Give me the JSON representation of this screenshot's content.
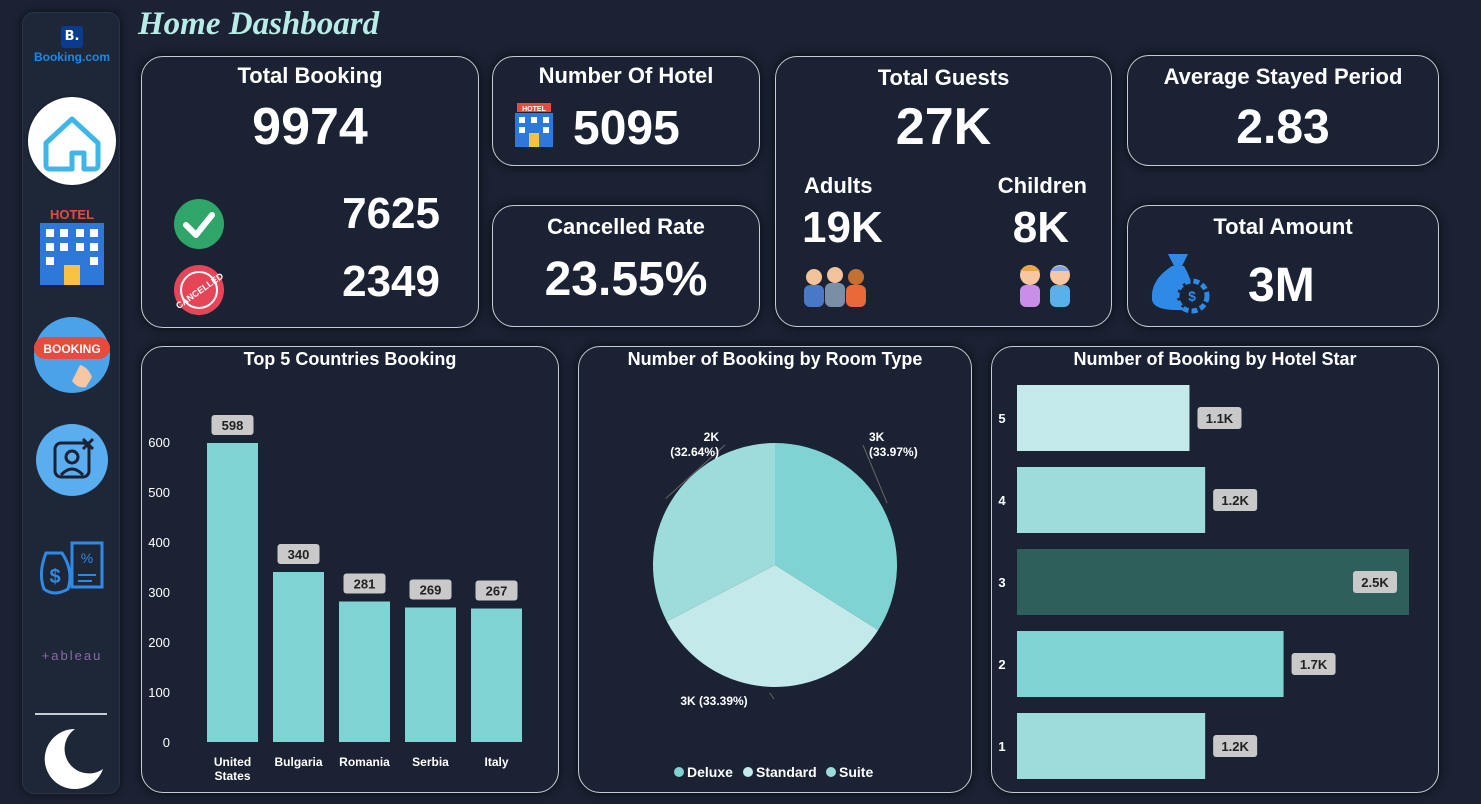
{
  "page_title": "Home Dashboard",
  "brand": {
    "letter": "B.",
    "name": "Booking.com"
  },
  "sidebar": {
    "items": [
      {
        "label": "home-icon"
      },
      {
        "label": "hotel-icon",
        "text": "HOTEL"
      },
      {
        "label": "booking-icon",
        "text": "BOOKING"
      },
      {
        "label": "cancel-user-icon"
      },
      {
        "label": "money-icon"
      },
      {
        "label": "tableau-logo",
        "text": "+ableau"
      },
      {
        "label": "moon-icon"
      }
    ]
  },
  "kpis": {
    "total_booking": {
      "title": "Total Booking",
      "value": "9974",
      "confirmed": "7625",
      "cancelled": "2349",
      "cancelled_stamp": "CANCELLED"
    },
    "number_of_hotel": {
      "title": "Number Of Hotel",
      "value": "5095",
      "icon_text": "HOTEL"
    },
    "cancelled_rate": {
      "title": "Cancelled Rate",
      "value": "23.55%"
    },
    "total_guests": {
      "title": "Total Guests",
      "value": "27K",
      "adults_label": "Adults",
      "adults_value": "19K",
      "children_label": "Children",
      "children_value": "8K"
    },
    "avg_stay": {
      "title": "Average Stayed Period",
      "value": "2.83"
    },
    "total_amount": {
      "title": "Total Amount",
      "value": "3M"
    }
  },
  "colors": {
    "bar": "#7fd3d3",
    "bar_dark": "#2f5f5b",
    "pie_deluxe": "#7fd3d3",
    "pie_standard": "#c3e9ea",
    "pie_suite": "#9edcdc",
    "bg": "#1a2233"
  },
  "chart_data": [
    {
      "type": "bar",
      "title": "Top 5 Countries Booking",
      "categories": [
        "United States",
        "Bulgaria",
        "Romania",
        "Serbia",
        "Italy"
      ],
      "values": [
        598,
        340,
        281,
        269,
        267
      ],
      "yticks": [
        0,
        100,
        200,
        300,
        400,
        500,
        600
      ],
      "ylim": [
        0,
        660
      ],
      "data_labels": [
        "598",
        "340",
        "281",
        "269",
        "267"
      ]
    },
    {
      "type": "pie",
      "title": "Number of Booking by Room Type",
      "slices": [
        {
          "name": "Deluxe",
          "value": 33.97,
          "label_value": "3K",
          "label_pct": "(33.97%)"
        },
        {
          "name": "Standard",
          "value": 33.39,
          "label_value": "3K",
          "label_pct": "(33.39%)"
        },
        {
          "name": "Suite",
          "value": 32.64,
          "label_value": "2K",
          "label_pct": "(32.64%)"
        }
      ],
      "legend": [
        "Deluxe",
        "Standard",
        "Suite"
      ]
    },
    {
      "type": "bar",
      "orientation": "horizontal",
      "title": "Number of Booking by Hotel Star",
      "categories": [
        "5",
        "4",
        "3",
        "2",
        "1"
      ],
      "values": [
        1100,
        1200,
        2500,
        1700,
        1200
      ],
      "data_labels": [
        "1.1K",
        "1.2K",
        "2.5K",
        "1.7K",
        "1.2K"
      ],
      "xlim": [
        0,
        2500
      ],
      "highlight": "3"
    }
  ]
}
